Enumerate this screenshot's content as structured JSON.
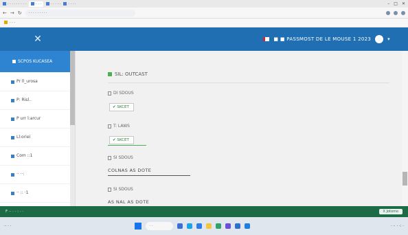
{
  "browser": {
    "tabs": [
      {
        "label": "· · · ·  ·  ·   ·  ·  ·",
        "active": false
      },
      {
        "label": "· ·  ·",
        "active": true
      },
      {
        "label": "· ·  ·  ·  ·",
        "active": false
      },
      {
        "label": "·  ·  ·  ·",
        "active": false
      }
    ],
    "url": "· ·  ·  ·  ·  ·  ·  ·  ·",
    "bookmark": "· ·  ·"
  },
  "header": {
    "user_text": "■ ■ PASSMOST DE LE MOUSE 1  2023",
    "close_symbol": "✕",
    "caret": "▾"
  },
  "sidebar": {
    "items": [
      {
        "label": "SCPOS KUCASEA",
        "active": true
      },
      {
        "label": "Pr ll_urosa",
        "active": false
      },
      {
        "label": "P: Risl..",
        "active": false
      },
      {
        "label": "P urr   l:arcur",
        "active": false
      },
      {
        "label": "Ll:oriei",
        "active": false
      },
      {
        "label": "Com ::1",
        "active": false
      },
      {
        "label": "·· ··:",
        "active": false
      },
      {
        "label": "·· :: ·1",
        "active": false
      }
    ]
  },
  "main": {
    "section_title": "SIL: OUTCAST",
    "fields": [
      {
        "label": "DI SDOUS",
        "badge": "✔ SKCET"
      },
      {
        "label": "T: LAWS",
        "badge": "✔ SKCET"
      },
      {
        "label": "SI SDOUS",
        "value": "COLNAS AS DOTE"
      },
      {
        "label": "SI SDOUS",
        "value": "AS NAL AS DOTE"
      }
    ]
  },
  "status": {
    "left": "F ·· ·  · :  ·  ·",
    "right": "X Jotomo"
  },
  "taskbar": {
    "weather": "·· ·   ·",
    "search": "· ·",
    "tray": "·  ··  ·  ·: ·"
  }
}
